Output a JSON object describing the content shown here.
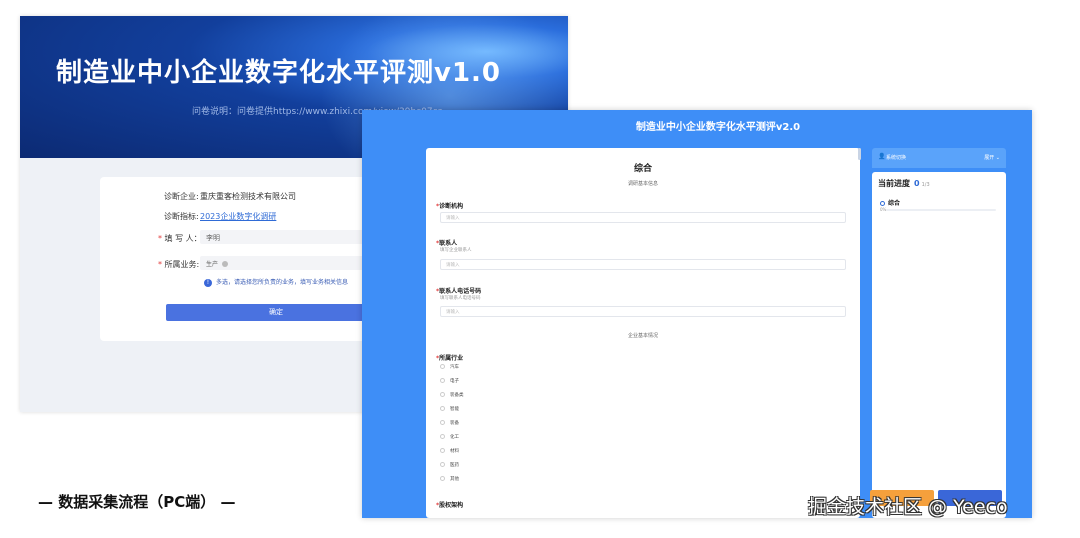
{
  "back": {
    "title": "制造业中小企业数字化水平评测v1.0",
    "subtitle": "问卷说明：问卷提供https://www.zhixi.com/view/39bc07ca",
    "fields": {
      "company_label": "诊断企业:",
      "company_value": "重庆重客检测技术有限公司",
      "metric_label": "诊断指标:",
      "metric_value": "2023企业数字化调研",
      "filler_req": "*",
      "filler_label": "填 写 人：",
      "filler_value": "李明",
      "business_req": "*",
      "business_label": "所属业务:",
      "business_tag": "生产",
      "tip": "多选，请选择您所负责的业务，填写业务相关信息",
      "tip_icon": "!",
      "submit": "确定"
    }
  },
  "front": {
    "title": "制造业中小企业数字化水平测评v2.0",
    "form": {
      "section_title": "综合",
      "section_sub": "调研基本信息",
      "q1": {
        "req": "*",
        "label": "诊断机构",
        "placeholder": "请输入"
      },
      "q2": {
        "req": "*",
        "label": "联系人",
        "hint": "填写企业联系人",
        "placeholder": "请输入"
      },
      "q3": {
        "req": "*",
        "label": "联系人电话号码",
        "hint": "填写联系人电话号码",
        "placeholder": "请输入"
      },
      "section2": "企业基本情况",
      "q4": {
        "req": "*",
        "label": "所属行业"
      },
      "options": [
        "汽车",
        "电子",
        "装备类",
        "智能",
        "装备",
        "化工",
        "材料",
        "医药",
        "其他"
      ],
      "q5": {
        "req": "*",
        "label": "股权架构"
      }
    },
    "side": {
      "head_icon": "👤",
      "head_label": "系统切换",
      "head_right": "展开 ⌄",
      "progress_label": "当前进度",
      "progress_count": "0",
      "progress_total": "1/3",
      "item": "综合",
      "pct": "0%",
      "progress_fraction": 0.0
    }
  },
  "caption": "— 数据采集流程（PC端） —",
  "watermark": "掘金技术社区 @ Yeeco"
}
